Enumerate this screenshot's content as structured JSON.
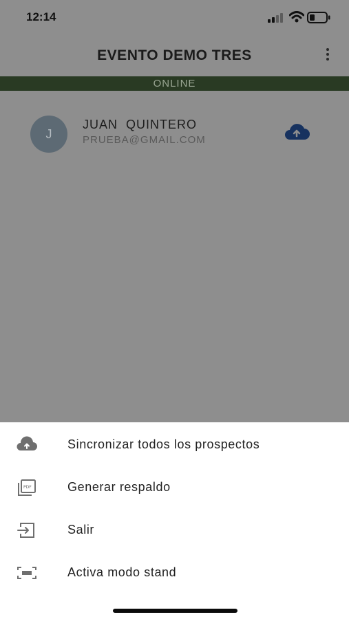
{
  "status_bar": {
    "time": "12:14",
    "icons": [
      "signal-icon",
      "wifi-icon",
      "battery-icon"
    ]
  },
  "header": {
    "title": "EVENTO DEMO TRES",
    "menu_icon": "more-vertical-icon"
  },
  "connection": {
    "status": "ONLINE",
    "color": "#293a23"
  },
  "contacts": [
    {
      "initial": "J",
      "name": "JUAN  QUINTERO",
      "email": "PRUEBA@GMAIL.COM",
      "action_icon": "cloud-upload-icon",
      "action_color": "#17325f"
    }
  ],
  "menu": {
    "items": [
      {
        "icon": "cloud-upload-icon",
        "label": "Sincronizar todos los prospectos"
      },
      {
        "icon": "pdf-icon",
        "label": "Generar respaldo"
      },
      {
        "icon": "logout-icon",
        "label": "Salir"
      },
      {
        "icon": "stand-mode-icon",
        "label": "Activa modo stand"
      }
    ]
  }
}
